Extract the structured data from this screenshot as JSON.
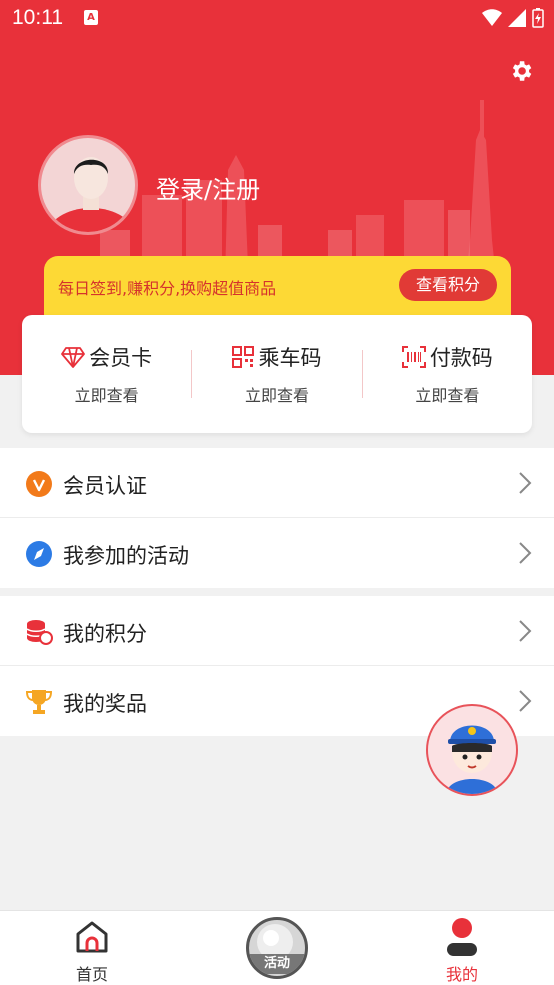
{
  "status_bar": {
    "time": "10:11",
    "notification_glyph": "A"
  },
  "header": {
    "login_label": "登录/注册",
    "points_promo": "每日签到,赚积分,换购超值商品",
    "points_button": "查看积分"
  },
  "card": {
    "items": [
      {
        "title": "会员卡",
        "sub": "立即查看",
        "icon": "diamond-icon"
      },
      {
        "title": "乘车码",
        "sub": "立即查看",
        "icon": "qrcode-icon"
      },
      {
        "title": "付款码",
        "sub": "立即查看",
        "icon": "barcode-icon"
      }
    ]
  },
  "menu": {
    "group1": [
      {
        "label": "会员认证",
        "icon": "verified-icon"
      },
      {
        "label": "我参加的活动",
        "icon": "compass-icon"
      }
    ],
    "group2": [
      {
        "label": "我的积分",
        "icon": "coins-icon"
      },
      {
        "label": "我的奖品",
        "icon": "trophy-icon"
      }
    ]
  },
  "tabbar": {
    "home": "首页",
    "activity": "活动",
    "mine": "我的"
  },
  "colors": {
    "brand_red": "#e8313a",
    "promo_yellow": "#fdd935",
    "tab_active": "#e8313a",
    "tab_inactive": "#333333"
  }
}
